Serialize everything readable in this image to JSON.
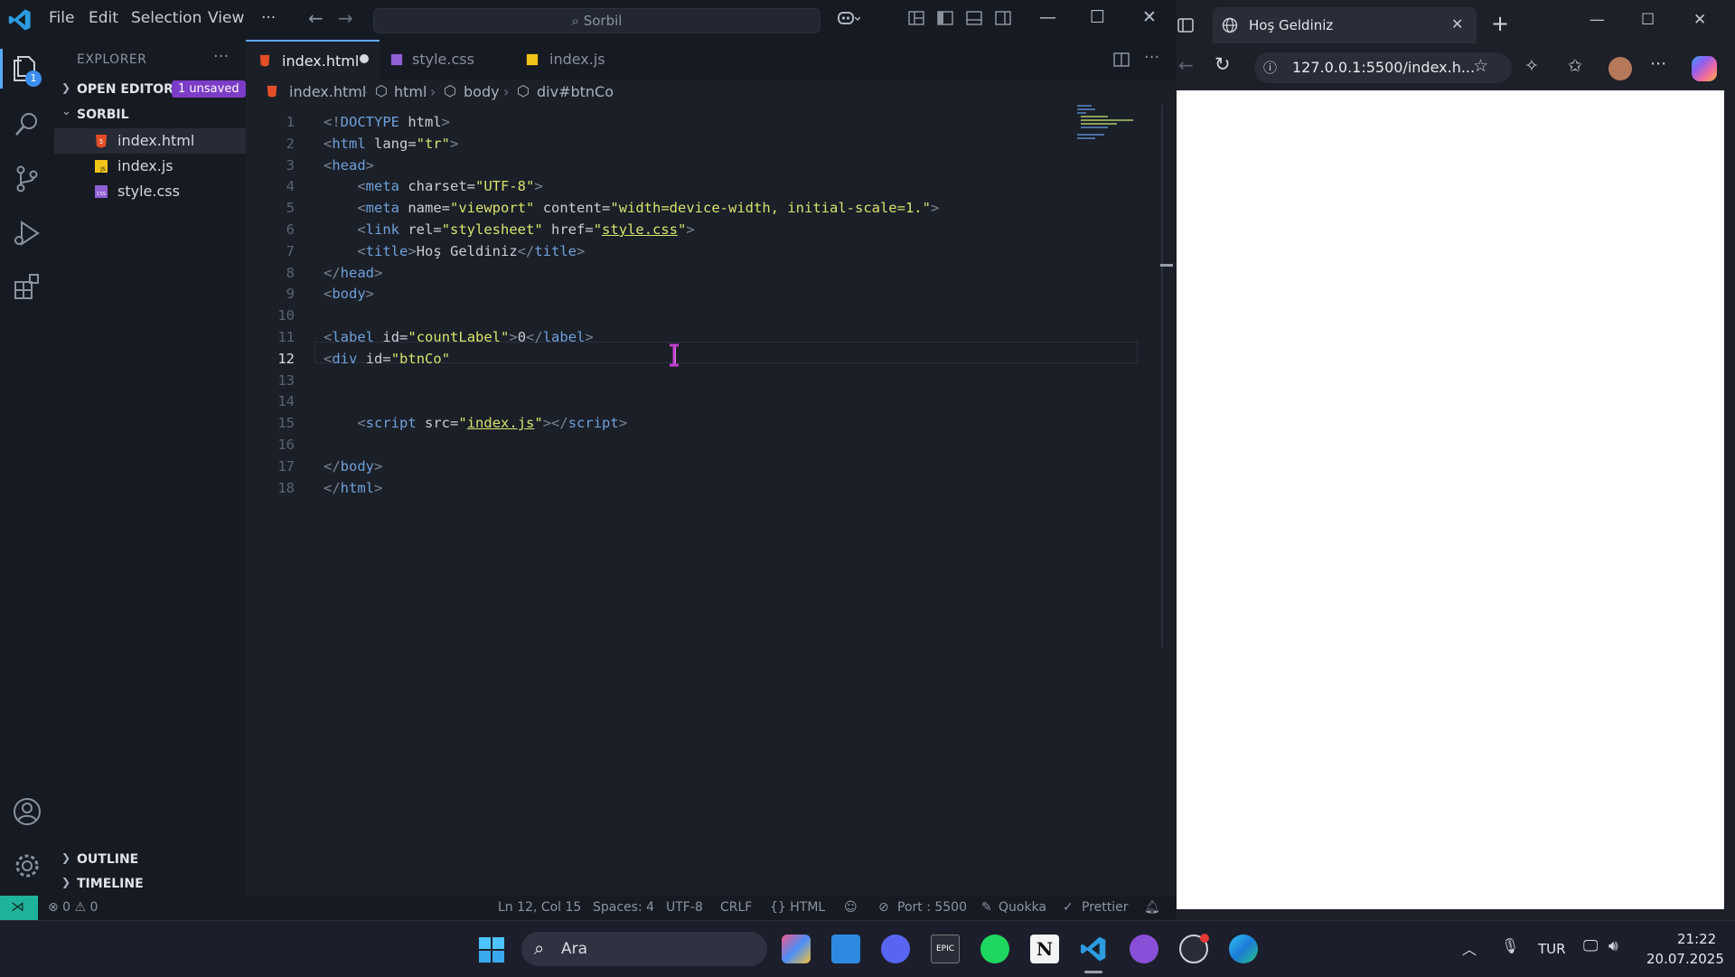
{
  "vscode": {
    "menu": [
      "File",
      "Edit",
      "Selection",
      "View",
      "···"
    ],
    "command_center": "Sorbil",
    "explorer": {
      "title": "EXPLORER",
      "open_editors_label": "OPEN EDITORS",
      "unsaved_badge": "1 unsaved",
      "folder_label": "SORBIL",
      "files": [
        "index.html",
        "index.js",
        "style.css"
      ],
      "outline_label": "OUTLINE",
      "timeline_label": "TIMELINE"
    },
    "activity_badge": "1",
    "tabs": [
      {
        "label": "index.html",
        "modified": true,
        "active": true
      },
      {
        "label": "style.css",
        "modified": false,
        "active": false
      },
      {
        "label": "index.js",
        "modified": false,
        "active": false
      }
    ],
    "breadcrumbs": [
      "index.html",
      "html",
      "body",
      "div#btnCo"
    ],
    "code_lines": [
      {
        "n": "1",
        "html": "<span class=\"p\">&lt;!</span><span class=\"t\">DOCTYPE</span> <span class=\"a\">html</span><span class=\"p\">&gt;</span>"
      },
      {
        "n": "2",
        "html": "<span class=\"p\">&lt;</span><span class=\"t\">html</span> <span class=\"a\">lang</span><span class=\"x\">=</span><span class=\"s\">\"tr\"</span><span class=\"p\">&gt;</span>"
      },
      {
        "n": "3",
        "html": "<span class=\"p\">&lt;</span><span class=\"t\">head</span><span class=\"p\">&gt;</span>"
      },
      {
        "n": "4",
        "html": "    <span class=\"p\">&lt;</span><span class=\"t\">meta</span> <span class=\"a\">charset</span><span class=\"x\">=</span><span class=\"s\">\"UTF-8\"</span><span class=\"p\">&gt;</span>"
      },
      {
        "n": "5",
        "html": "    <span class=\"p\">&lt;</span><span class=\"t\">meta</span> <span class=\"a\">name</span><span class=\"x\">=</span><span class=\"s\">\"viewport\"</span> <span class=\"a\">content</span><span class=\"x\">=</span><span class=\"s\">\"width=device-width, initial-scale=1.\"</span><span class=\"p\">&gt;</span>"
      },
      {
        "n": "6",
        "html": "    <span class=\"p\">&lt;</span><span class=\"t\">link</span> <span class=\"a\">rel</span><span class=\"x\">=</span><span class=\"s\">\"stylesheet\"</span> <span class=\"a\">href</span><span class=\"x\">=</span><span class=\"s\">\"<span class=\"u\">style.css</span>\"</span><span class=\"p\">&gt;</span>"
      },
      {
        "n": "7",
        "html": "    <span class=\"p\">&lt;</span><span class=\"t\">title</span><span class=\"p\">&gt;</span><span class=\"x\">Hoş Geldiniz</span><span class=\"p\">&lt;/</span><span class=\"t\">title</span><span class=\"p\">&gt;</span>"
      },
      {
        "n": "8",
        "html": "<span class=\"p\">&lt;/</span><span class=\"t\">head</span><span class=\"p\">&gt;</span>"
      },
      {
        "n": "9",
        "html": "<span class=\"p\">&lt;</span><span class=\"t\">body</span><span class=\"p\">&gt;</span>"
      },
      {
        "n": "10",
        "html": ""
      },
      {
        "n": "11",
        "html": "<span class=\"p\">&lt;</span><span class=\"t\">label</span> <span class=\"a\">id</span><span class=\"x\">=</span><span class=\"s\">\"countLabel\"</span><span class=\"p\">&gt;</span><span class=\"x\">0</span><span class=\"p\">&lt;/</span><span class=\"t\">label</span><span class=\"p\">&gt;</span>"
      },
      {
        "n": "12",
        "html": "<span class=\"p\">&lt;</span><span class=\"t\">div</span> <span class=\"a\">id</span><span class=\"x\">=</span><span class=\"s\">\"btnCo\"</span>"
      },
      {
        "n": "13",
        "html": ""
      },
      {
        "n": "14",
        "html": ""
      },
      {
        "n": "15",
        "html": "    <span class=\"p\">&lt;</span><span class=\"t\">script</span> <span class=\"a\">src</span><span class=\"x\">=</span><span class=\"s\">\"<span class=\"u\">index.js</span>\"</span><span class=\"p\">&gt;&lt;/</span><span class=\"t\">script</span><span class=\"p\">&gt;</span>"
      },
      {
        "n": "16",
        "html": ""
      },
      {
        "n": "17",
        "html": "<span class=\"p\">&lt;/</span><span class=\"t\">body</span><span class=\"p\">&gt;</span>"
      },
      {
        "n": "18",
        "html": "<span class=\"p\">&lt;/</span><span class=\"t\">html</span><span class=\"p\">&gt;</span>"
      }
    ],
    "status": {
      "problems": "⊗ 0 ⚠ 0",
      "position": "Ln 12, Col 15",
      "spaces": "Spaces: 4",
      "encoding": "UTF-8",
      "eol": "CRLF",
      "language": "{} HTML",
      "port": "Port : 5500",
      "quokka": "Quokka",
      "prettier": "Prettier"
    }
  },
  "browser": {
    "tab_title": "Hoş Geldiniz",
    "url": "127.0.0.1:5500/index.h..."
  },
  "taskbar": {
    "search_placeholder": "Ara",
    "language": "TUR",
    "time": "21:22",
    "date": "20.07.2025"
  },
  "colors": {
    "accent_badge": "#7b3cc7",
    "remote_indicator": "#1fb39a",
    "html_file": "#e44d26",
    "js_file": "#f0c419",
    "css_file": "#8f5fd6"
  }
}
